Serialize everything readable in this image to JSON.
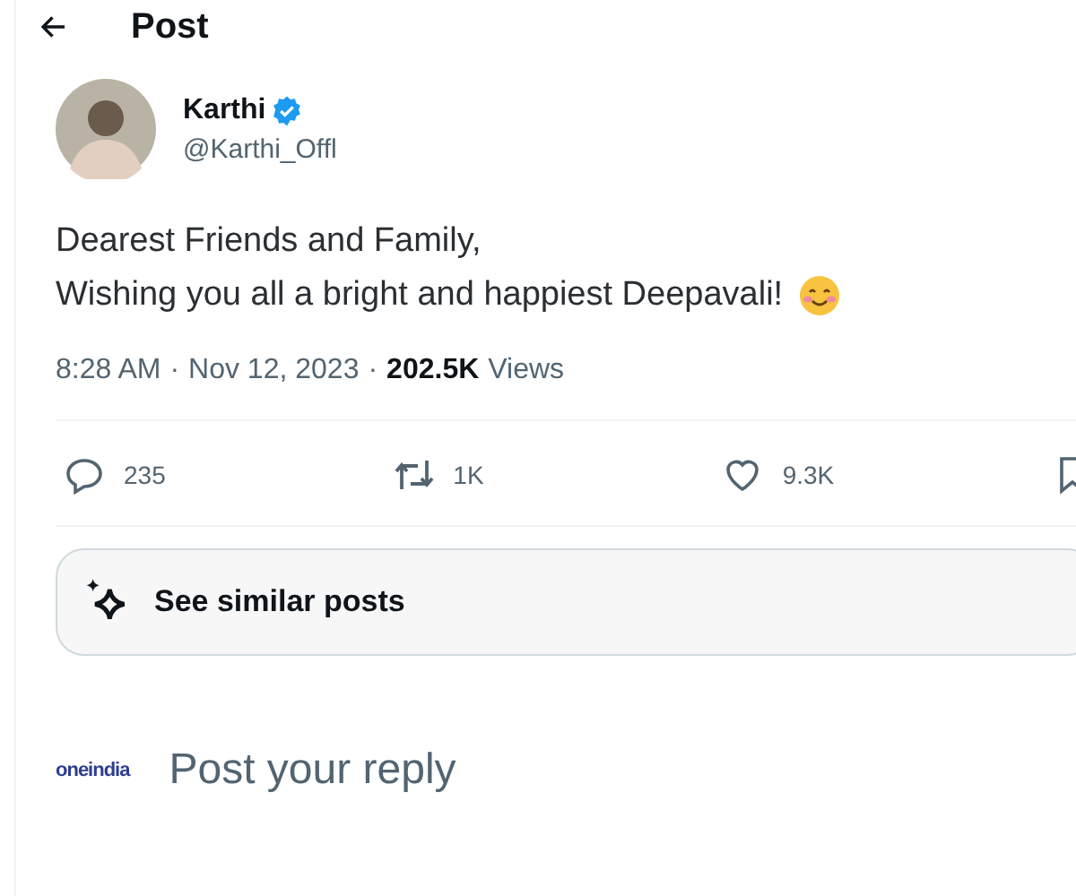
{
  "header": {
    "title": "Post"
  },
  "author": {
    "name": "Karthi",
    "verified": true,
    "handle": "@Karthi_Offl"
  },
  "body": {
    "lines": [
      "Dearest Friends and Family,",
      "Wishing you all a bright and happiest Deepavali!"
    ]
  },
  "meta": {
    "time": "8:28 AM",
    "separator": "·",
    "date": "Nov 12, 2023",
    "views_count": "202.5K",
    "views_label": "Views"
  },
  "actions": [
    {
      "kind": "reply",
      "count": "235"
    },
    {
      "kind": "repost",
      "count": "1K"
    },
    {
      "kind": "like",
      "count": "9.3K"
    },
    {
      "kind": "bookmark"
    }
  ],
  "similar_button": {
    "label": "See similar posts"
  },
  "reply_box": {
    "avatar_text": "oneindia",
    "placeholder": "Post your reply"
  }
}
